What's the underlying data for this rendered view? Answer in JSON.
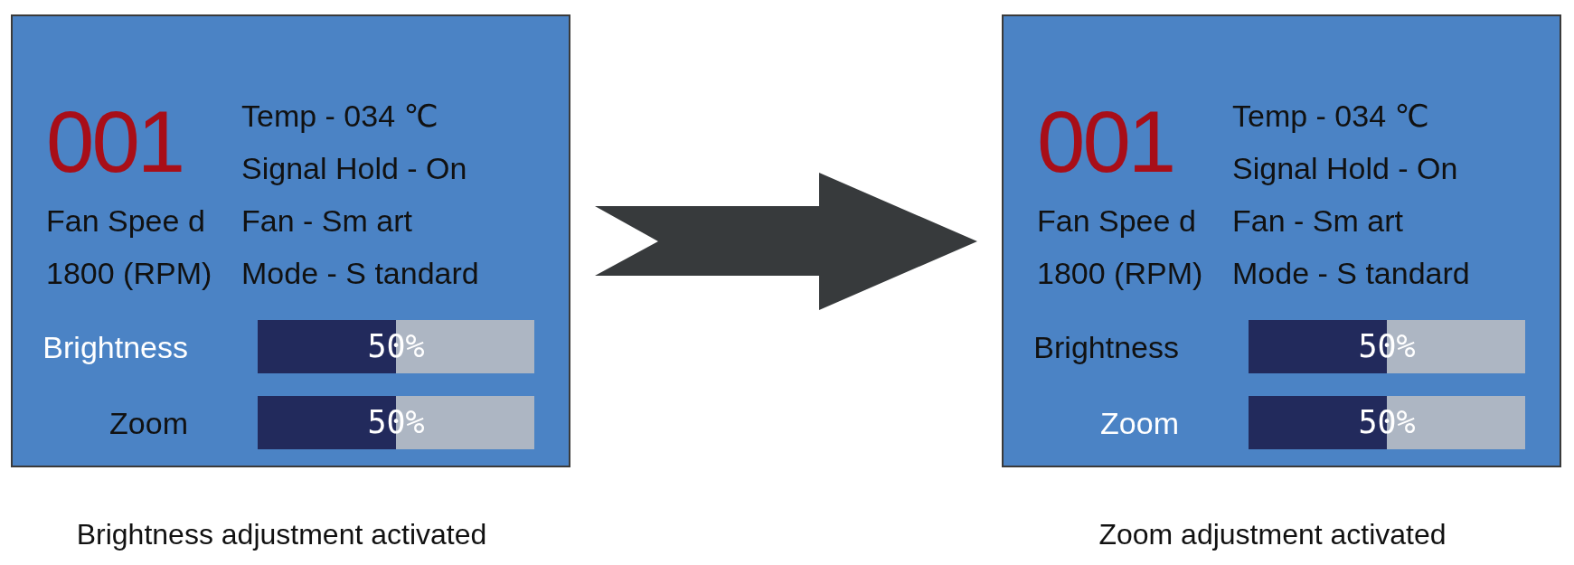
{
  "panels": [
    {
      "number": "001",
      "settings": [
        "Temp - 034 ℃",
        "Signal Hold - On",
        "Fan - Sm art",
        "Mode - S tandard"
      ],
      "fan_speed": [
        "Fan Spee d",
        "1800 (RPM)"
      ],
      "adjustments": [
        {
          "label": "Brightness",
          "selected": true,
          "level": 0.5,
          "reading": "50%"
        },
        {
          "label": "Zoom",
          "selected": false,
          "level": 0.5,
          "reading": "50%"
        }
      ],
      "caption": "Brightness adjustment activated"
    },
    {
      "number": "001",
      "settings": [
        "Temp - 034 ℃",
        "Signal Hold - On",
        "Fan - Sm art",
        "Mode - S tandard"
      ],
      "fan_speed": [
        "Fan Spee d",
        "1800 (RPM)"
      ],
      "adjustments": [
        {
          "label": "Brightness",
          "selected": false,
          "level": 0.5,
          "reading": "50%"
        },
        {
          "label": "Zoom",
          "selected": true,
          "level": 0.5,
          "reading": "50%"
        }
      ],
      "caption": "Zoom adjustment activated"
    }
  ]
}
